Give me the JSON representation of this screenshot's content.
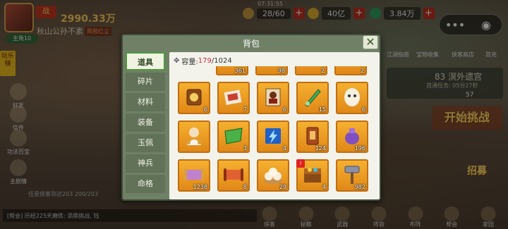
{
  "player": {
    "power": "2990.33万",
    "power_badge": "战",
    "guild": "秋山公孙不素",
    "guild_tag": "周报红尘",
    "level": "主角10"
  },
  "top": {
    "timer": "07:31:55",
    "resources": [
      {
        "icon": "coin-icon",
        "value": "28/60"
      },
      {
        "icon": "gold-icon",
        "value": "40亿"
      },
      {
        "icon": "jade-icon",
        "value": "3.84万"
      }
    ]
  },
  "sidebar": {
    "promo": "玩乐赚",
    "items": [
      "好友",
      "信件",
      "功法百宝",
      "主剧情"
    ]
  },
  "background": {
    "quest_title": "83 溟外遗宫",
    "quest_sub": "首通任务: 05分27秒",
    "quest_count": "57",
    "start_label": "开始挑战",
    "recruit_label": "招募",
    "top_links": [
      "江湖指南",
      "宝物收集",
      "侠客商店",
      "首充"
    ],
    "bottom_tip": "任意侠客到达203 200/203",
    "chat_text": "[帮会] 历经225天磨练: 添鼎挑战, 钰",
    "nav": [
      "侠客",
      "秘籍",
      "武器",
      "阵容",
      "布阵",
      "帮会",
      "家园"
    ]
  },
  "bag": {
    "title": "背包",
    "close_label": "✕",
    "tabs": [
      "道具",
      "碎片",
      "材料",
      "装备",
      "玉佩",
      "神兵",
      "命格"
    ],
    "active_tab": 0,
    "capacity_label": "容量:",
    "capacity_current": "179",
    "capacity_total": "/1024",
    "items": [
      {
        "name": "partial-item-1",
        "count": "361"
      },
      {
        "name": "partial-item-2",
        "count": "98"
      },
      {
        "name": "partial-item-3",
        "count": "2"
      },
      {
        "name": "partial-item-4",
        "count": "5"
      },
      {
        "name": "partial-item-5",
        "count": "2"
      },
      {
        "name": "token-plaque",
        "count": "6"
      },
      {
        "name": "scroll-painting",
        "count": "7"
      },
      {
        "name": "warrior-card",
        "count": "6"
      },
      {
        "name": "jade-sword",
        "count": "15"
      },
      {
        "name": "ghost-mask",
        "count": "6"
      },
      {
        "name": "immortal-elder",
        "count": ""
      },
      {
        "name": "green-banner",
        "count": "3"
      },
      {
        "name": "blue-lightning-card",
        "count": "4"
      },
      {
        "name": "command-token",
        "count": "124"
      },
      {
        "name": "purple-pouch",
        "count": "196"
      },
      {
        "name": "recruit-scroll",
        "count": "1238"
      },
      {
        "name": "battle-scroll",
        "count": "8"
      },
      {
        "name": "steamed-buns",
        "count": "29"
      },
      {
        "name": "treasure-box",
        "count": "4"
      },
      {
        "name": "hammer",
        "count": "982"
      }
    ]
  },
  "colors": {
    "panel": "#6f8067",
    "cell": "#f0a024",
    "active_tab_border": "#4b9a3a",
    "capacity_current": "#d03030"
  }
}
